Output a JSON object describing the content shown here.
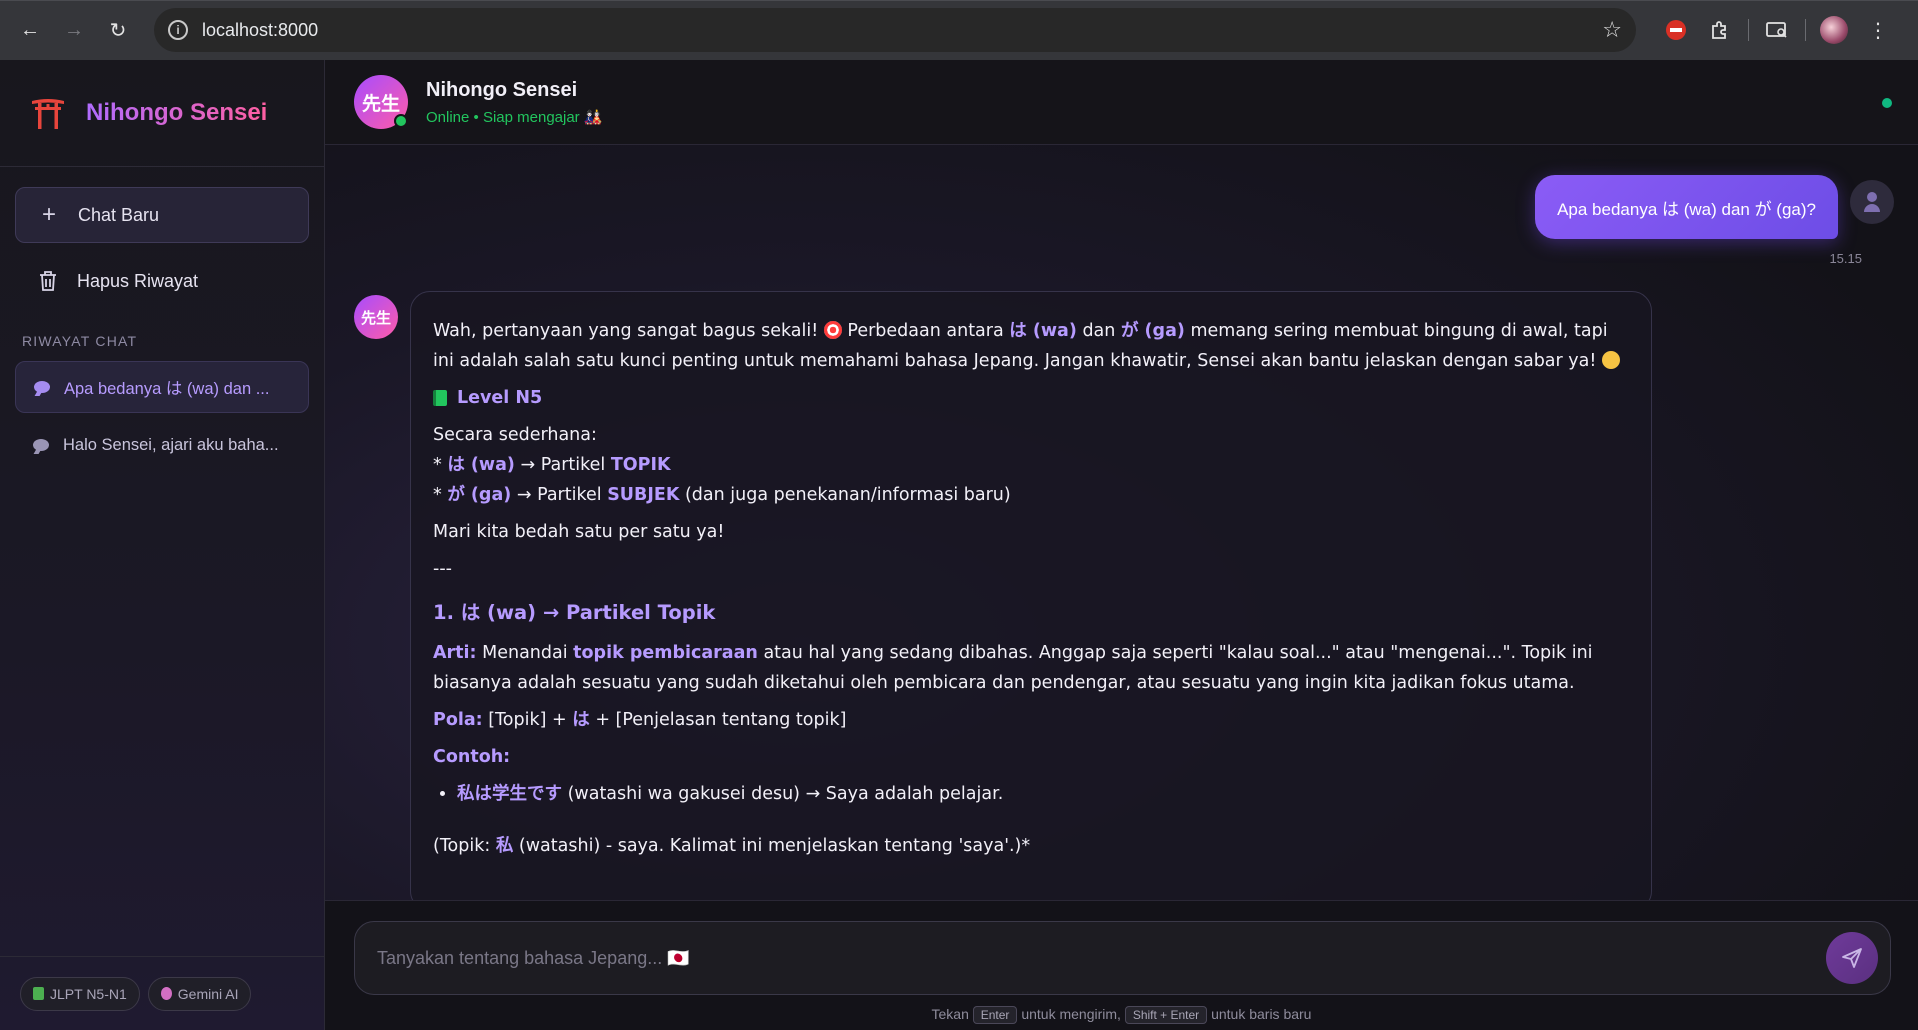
{
  "browser": {
    "url": "localhost:8000"
  },
  "sidebar": {
    "brand": "Nihongo Sensei",
    "new_chat": "Chat Baru",
    "clear_history": "Hapus Riwayat",
    "history_label": "RIWAYAT CHAT",
    "history": [
      {
        "label": "Apa bedanya は (wa) dan ..."
      },
      {
        "label": "Halo Sensei, ajari aku baha..."
      }
    ],
    "badges": [
      "JLPT N5-N1",
      "Gemini AI"
    ]
  },
  "header": {
    "avatar": "先生",
    "title": "Nihongo Sensei",
    "status": "Online • Siap mengajar 🎎"
  },
  "user_message": {
    "text": "Apa bedanya は (wa) dan が (ga)?",
    "time": "15.15"
  },
  "bot": {
    "avatar": "先生",
    "intro_a": "Wah, pertanyaan yang sangat bagus sekali!",
    "intro_b": "Perbedaan antara",
    "wa": "は (wa)",
    "dan": "dan",
    "ga": "が (ga)",
    "intro_c": "memang sering membuat bingung di awal, tapi ini adalah salah satu kunci penting untuk memahami bahasa Jepang. Jangan khawatir, Sensei akan bantu jelaskan dengan sabar ya!",
    "level": "Level N5",
    "simple": "Secara sederhana:",
    "b1_pre": "*",
    "b1_arrow": "→ Partikel",
    "b1_topic": "TOPIK",
    "b2_pre": "*",
    "b2_arrow": "→ Partikel",
    "b2_subj": "SUBJEK",
    "b2_tail": "(dan juga penekanan/informasi baru)",
    "lets": "Mari kita bedah satu per satu ya!",
    "divider": "---",
    "sec1": "1. は (wa) → Partikel Topik",
    "arti_label": "Arti:",
    "arti_a": "Menandai",
    "arti_hl": "topik pembicaraan",
    "arti_b": "atau hal yang sedang dibahas. Anggap saja seperti \"kalau soal...\" atau \"mengenai...\". Topik ini biasanya adalah sesuatu yang sudah diketahui oleh pembicara dan pendengar, atau sesuatu yang ingin kita jadikan fokus utama.",
    "pola_label": "Pola:",
    "pola_a": "[Topik] +",
    "pola_hl": "は",
    "pola_b": "+ [Penjelasan tentang topik]",
    "contoh_label": "Contoh:",
    "ex1_jp": "私は学生です",
    "ex1_rest": "(watashi wa gakusei desu) → Saya adalah pelajar.",
    "note_a": "(Topik:",
    "note_hl": "私",
    "note_b": "(watashi) - saya. Kalimat ini menjelaskan tentang 'saya'.)*"
  },
  "input": {
    "placeholder": "Tanyakan tentang bahasa Jepang... 🇯🇵",
    "hint_a": "Tekan",
    "hint_enter": "Enter",
    "hint_b": "untuk mengirim,",
    "hint_shift": "Shift + Enter",
    "hint_c": "untuk baris baru"
  },
  "colors": {
    "accent": "#8b5cf6",
    "highlight": "#b69bff",
    "online": "#22c55e"
  }
}
